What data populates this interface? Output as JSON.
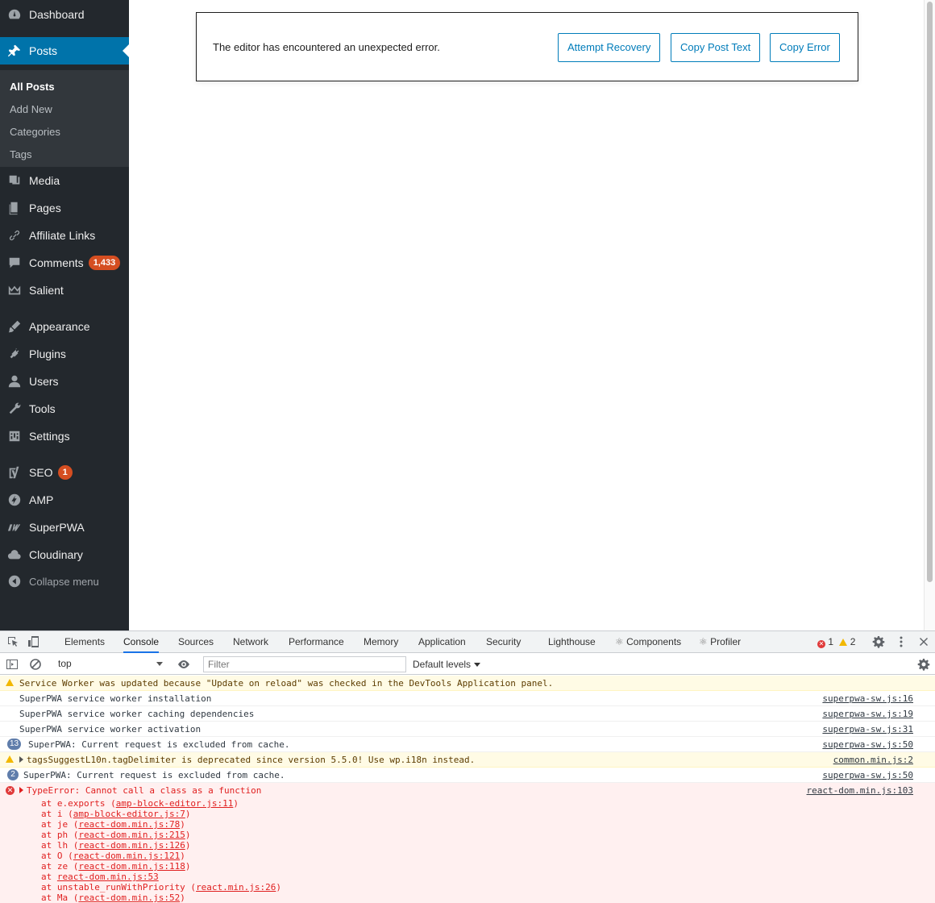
{
  "sidebar": {
    "dashboard": "Dashboard",
    "posts": "Posts",
    "submenu": [
      "All Posts",
      "Add New",
      "Categories",
      "Tags"
    ],
    "media": "Media",
    "pages": "Pages",
    "affiliate_links": "Affiliate Links",
    "comments": "Comments",
    "comments_count": "1,433",
    "salient": "Salient",
    "appearance": "Appearance",
    "plugins": "Plugins",
    "users": "Users",
    "tools": "Tools",
    "settings": "Settings",
    "seo": "SEO",
    "seo_count": "1",
    "amp": "AMP",
    "superpwa": "SuperPWA",
    "cloudinary": "Cloudinary",
    "collapse": "Collapse menu"
  },
  "editor_error": {
    "message": "The editor has encountered an unexpected error.",
    "attempt_recovery": "Attempt Recovery",
    "copy_post_text": "Copy Post Text",
    "copy_error": "Copy Error"
  },
  "devtools": {
    "tabs": [
      "Elements",
      "Console",
      "Sources",
      "Network",
      "Performance",
      "Memory",
      "Application",
      "Security",
      "Lighthouse",
      "Components",
      "Profiler"
    ],
    "error_count": "1",
    "warning_count": "2",
    "context": "top",
    "filter_placeholder": "Filter",
    "levels": "Default levels",
    "messages": [
      {
        "type": "warn",
        "text": "Service Worker was updated because \"Update on reload\" was checked in the DevTools Application panel.",
        "source": ""
      },
      {
        "type": "log",
        "text": "SuperPWA service worker installation",
        "source": "superpwa-sw.js:16"
      },
      {
        "type": "log",
        "text": "SuperPWA service worker caching dependencies",
        "source": "superpwa-sw.js:19"
      },
      {
        "type": "log",
        "text": "SuperPWA service worker activation",
        "source": "superpwa-sw.js:31"
      },
      {
        "type": "log",
        "count": "13",
        "text": "SuperPWA: Current request is excluded from cache.",
        "source": "superpwa-sw.js:50"
      },
      {
        "type": "warn",
        "text": "tagsSuggestL10n.tagDelimiter is deprecated since version 5.5.0! Use wp.i18n instead.",
        "source": "common.min.js:2"
      },
      {
        "type": "log",
        "count": "2",
        "text": "SuperPWA: Current request is excluded from cache.",
        "source": "superpwa-sw.js:50"
      },
      {
        "type": "error",
        "text": "TypeError: Cannot call a class as a function",
        "source": "react-dom.min.js:103"
      }
    ],
    "stack": [
      {
        "fn": "e.exports",
        "loc": "amp-block-editor.js:11"
      },
      {
        "fn": "i",
        "loc": "amp-block-editor.js:7"
      },
      {
        "fn": "je",
        "loc": "react-dom.min.js:78"
      },
      {
        "fn": "ph",
        "loc": "react-dom.min.js:215"
      },
      {
        "fn": "lh",
        "loc": "react-dom.min.js:126"
      },
      {
        "fn": "O",
        "loc": "react-dom.min.js:121"
      },
      {
        "fn": "ze",
        "loc": "react-dom.min.js:118"
      },
      {
        "fn": "",
        "loc": "react-dom.min.js:53"
      },
      {
        "fn": "unstable_runWithPriority",
        "loc": "react.min.js:26"
      },
      {
        "fn": "Ma",
        "loc": "react-dom.min.js:52"
      }
    ]
  }
}
